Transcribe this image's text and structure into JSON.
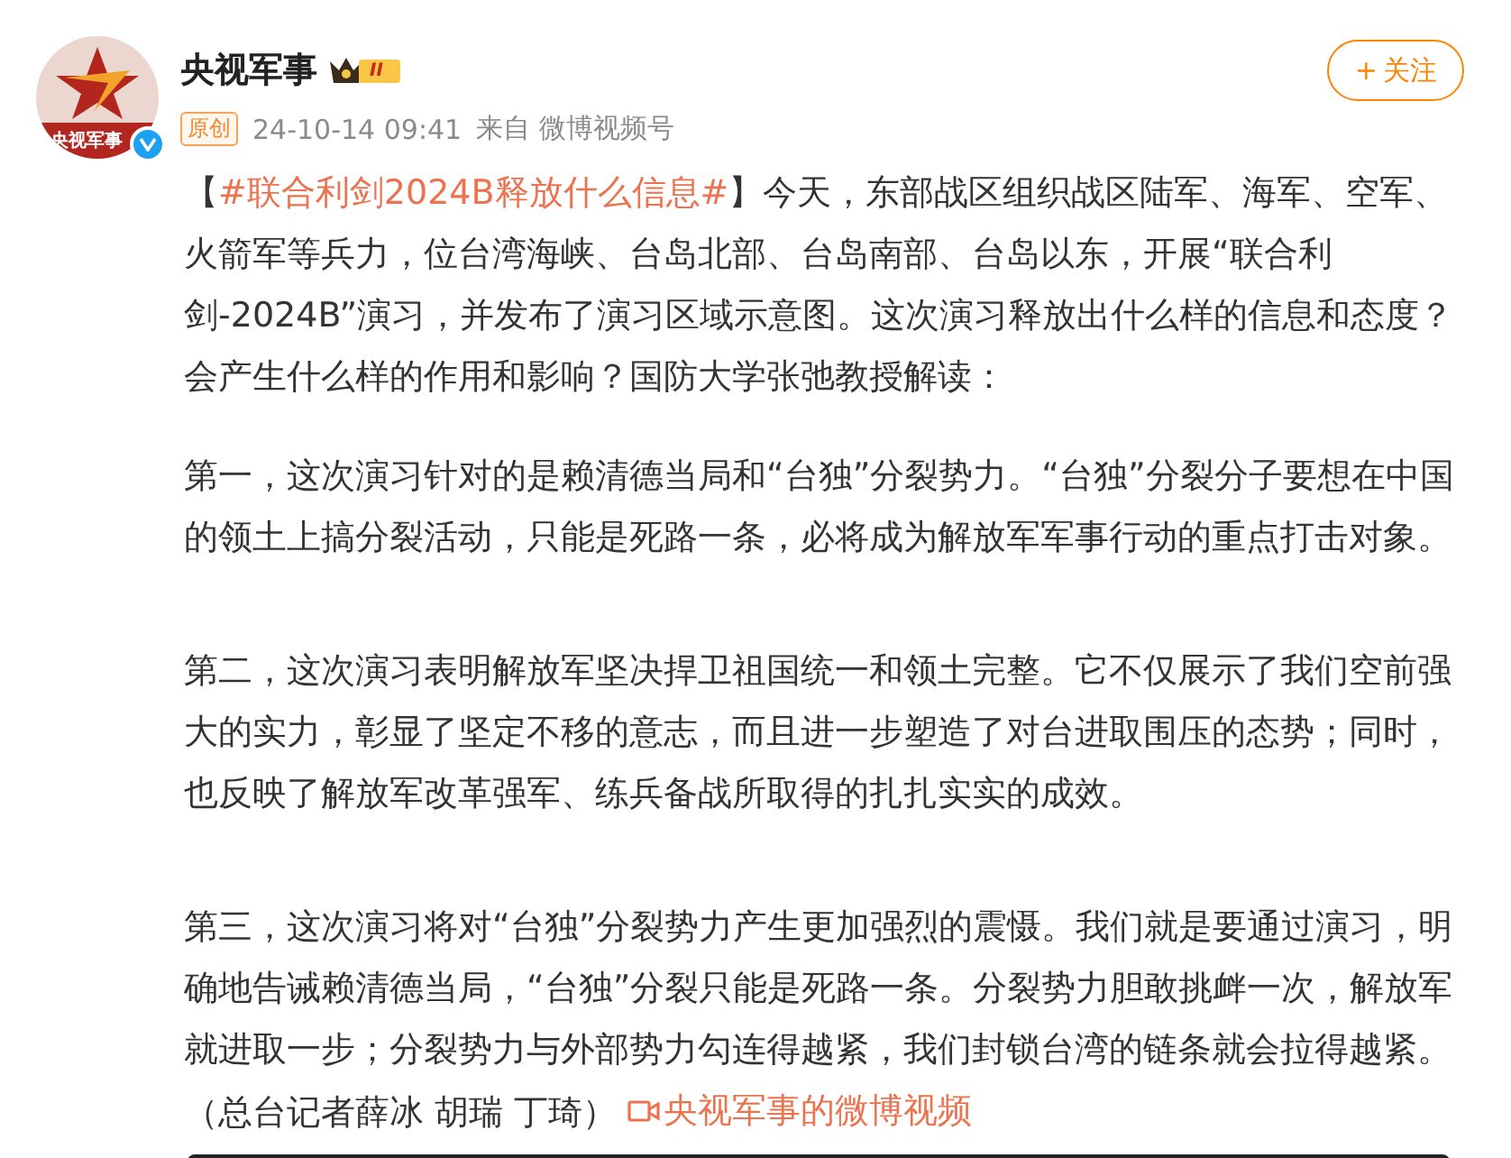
{
  "author": {
    "name": "央视军事",
    "avatar_caption": "央视军事",
    "verified": true,
    "level_badge": "II"
  },
  "meta": {
    "original_tag": "原创",
    "time": "24-10-14 09:41",
    "source": "来自 微博视频号"
  },
  "follow_button": {
    "label": "关注",
    "icon": "+"
  },
  "post": {
    "intro": {
      "open_bracket": "【",
      "hashtag": "#联合利剑2024B释放什么信息#",
      "text": "】今天，东部战区组织战区陆军、海军、空军、火箭军等兵力，位台湾海峡、台岛北部、台岛南部、台岛以东，开展“联合利剑-2024B”演习，并发布了演习区域示意图。这次演习释放出什么样的信息和态度？会产生什么样的作用和影响？国防大学张弛教授解读："
    },
    "paragraphs": [
      "第一，这次演习针对的是赖清德当局和“台独”分裂势力。“台独”分裂分子要想在中国的领土上搞分裂活动，只能是死路一条，必将成为解放军军事行动的重点打击对象。",
      "第二，这次演习表明解放军坚决捍卫祖国统一和领土完整。它不仅展示了我们空前强大的实力，彰显了坚定不移的意志，而且进一步塑造了对台进取围压的态势；同时，也反映了解放军改革强军、练兵备战所取得的扎扎实实的成效。"
    ],
    "final": {
      "text": "第三，这次演习将对“台独”分裂势力产生更加强烈的震慑。我们就是要通过演习，明确地告诫赖清德当局，“台独”分裂只能是死路一条。分裂势力胆敢挑衅一次，解放军就进取一步；分裂势力与外部势力勾连得越紧，我们封锁台湾的链条就会拉得越紧。（总台记者薛冰 胡瑞 丁琦）",
      "video_link": "央视军事的微博视频"
    }
  }
}
